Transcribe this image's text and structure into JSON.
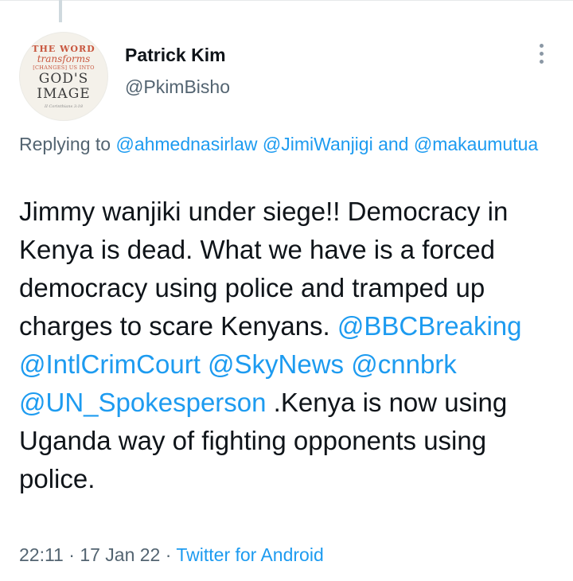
{
  "tweet": {
    "avatar": {
      "line1": "THE WORD",
      "line2": "transforms",
      "line3": "[CHANGES] US INTO",
      "line4": "GOD'S",
      "line5": "IMAGE",
      "line6": "II Corinthians 3:18"
    },
    "display_name": "Patrick Kim",
    "handle": "@PkimBisho",
    "replying": {
      "prefix": "Replying to ",
      "mention1": "@ahmednasirlaw",
      "mention2": "@JimiWanjigi",
      "and": " and",
      "mention3": "@makaumutua"
    },
    "text": {
      "part1": "Jimmy wanjiki under siege!! Democracy in Kenya is dead. What we have is a forced democracy using police and tramped up charges to scare Kenyans.",
      "mention_bbc": "@BBCBreaking",
      "mention_icc": "@IntlCrimCourt",
      "mention_sky": "@SkyNews",
      "mention_cnn": "@cnnbrk",
      "mention_un": "@UN_Spokesperson",
      "part2": ".Kenya is now using Uganda way of fighting opponents using police."
    },
    "meta": {
      "time": "22:11",
      "sep1": " · ",
      "date": "17 Jan 22",
      "sep2": " · ",
      "source": "Twitter for Android"
    }
  },
  "colors": {
    "text": "#0f1419",
    "secondary": "#536471",
    "link": "#1d9bf0",
    "background": "#ffffff"
  },
  "icons": {
    "more": "more-vertical-icon"
  }
}
